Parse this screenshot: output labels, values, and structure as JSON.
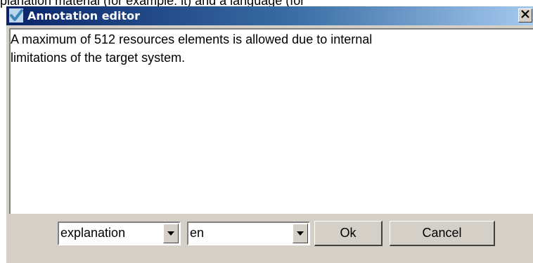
{
  "top_text": "planation material (for example: it) and a language (for",
  "window": {
    "title": "Annotation editor",
    "close_label": "×"
  },
  "editor": {
    "text": "A maximum of 512 resources elements is allowed due to internal\nlimitations of the target system."
  },
  "controls": {
    "type_select": "explanation",
    "language_select": "en",
    "ok_label": "Ok",
    "cancel_label": "Cancel"
  },
  "icons": {
    "title": "checkmark-icon",
    "close": "close-icon",
    "dropdown": "chevron-down-icon"
  }
}
